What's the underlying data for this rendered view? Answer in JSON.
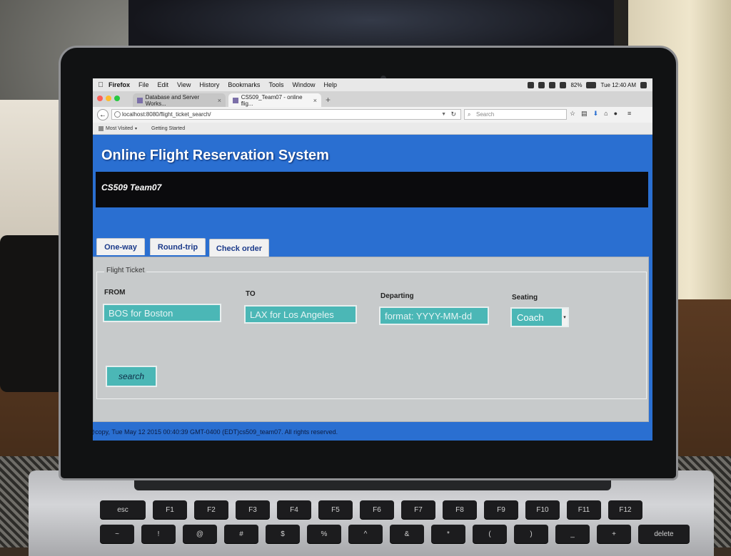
{
  "menubar": {
    "app": "Firefox",
    "items": [
      "File",
      "Edit",
      "View",
      "History",
      "Bookmarks",
      "Tools",
      "Window",
      "Help"
    ],
    "battery": "82%",
    "clock": "Tue 12:40 AM"
  },
  "tabs": [
    {
      "label": "Database and Server Works..."
    },
    {
      "label": "CS509_Team07 - online flig..."
    }
  ],
  "url": "localhost:8080/flight_ticket_search/",
  "search_placeholder": "Search",
  "bookmarks": [
    "Most Visited",
    "Getting Started"
  ],
  "page": {
    "title": "Online Flight Reservation System",
    "team": "CS509 Team07",
    "tabs": [
      "One-way",
      "Round-trip",
      "Check order"
    ],
    "legend": "Flight Ticket",
    "fields": {
      "from_label": "FROM",
      "from_placeholder": "BOS for Boston",
      "to_label": "TO",
      "to_placeholder": "LAX for Los Angeles",
      "departing_label": "Departing",
      "departing_placeholder": "format: YYYY-MM-dd",
      "seating_label": "Seating",
      "seating_value": "Coach"
    },
    "search_button": "search",
    "footer": "@copy, Tue May 12 2015 00:40:39 GMT-0400 (EDT)cs509_team07. All rights reserved."
  },
  "colors": {
    "page_bg": "#2a6fd1",
    "input_bg": "#4bb7b6",
    "panel_bg": "#c7cacb",
    "band_bg": "#0b0b0d"
  },
  "keyboard": {
    "row1": [
      "esc",
      "F1",
      "F2",
      "F3",
      "F4",
      "F5",
      "F6",
      "F7",
      "F8",
      "F9",
      "F10",
      "F11",
      "F12"
    ],
    "row2": [
      "~",
      "!",
      "@",
      "#",
      "$",
      "%",
      "^",
      "&",
      "*",
      "(",
      ")",
      "_",
      "+",
      "delete"
    ]
  }
}
